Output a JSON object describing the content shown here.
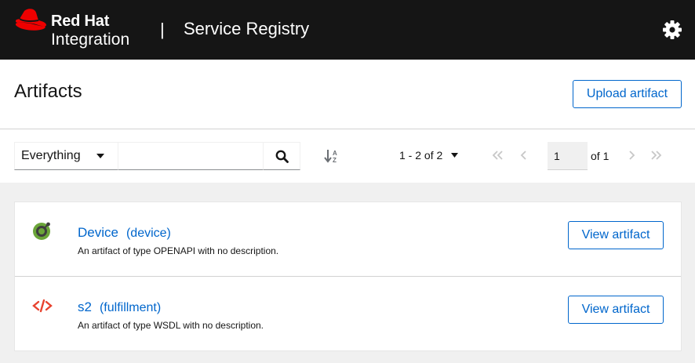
{
  "header": {
    "brand_line1": "Red Hat",
    "brand_line2": "Integration",
    "separator": "|",
    "product": "Service Registry",
    "settings_icon": "gear-icon"
  },
  "page": {
    "title": "Artifacts",
    "upload_label": "Upload artifact"
  },
  "toolbar": {
    "filter_selected": "Everything",
    "search_value": "",
    "search_placeholder": "",
    "pagination_label": "1 - 2 of 2",
    "current_page": "1",
    "of_pages": "of 1"
  },
  "artifacts": [
    {
      "name": "Device",
      "id": "(device)",
      "description": "An artifact of type OPENAPI with no description.",
      "type_icon": "openapi-icon",
      "action": "View artifact"
    },
    {
      "name": "s2",
      "id": "(fulfillment)",
      "description": "An artifact of type WSDL with no description.",
      "type_icon": "code-icon",
      "action": "View artifact"
    }
  ],
  "colors": {
    "masthead": "#151515",
    "accent": "#0066cc",
    "list_background": "#f0f0f0",
    "brand_red": "#ee0000",
    "openapi_green": "#6ba539",
    "code_red": "#e8432f"
  }
}
